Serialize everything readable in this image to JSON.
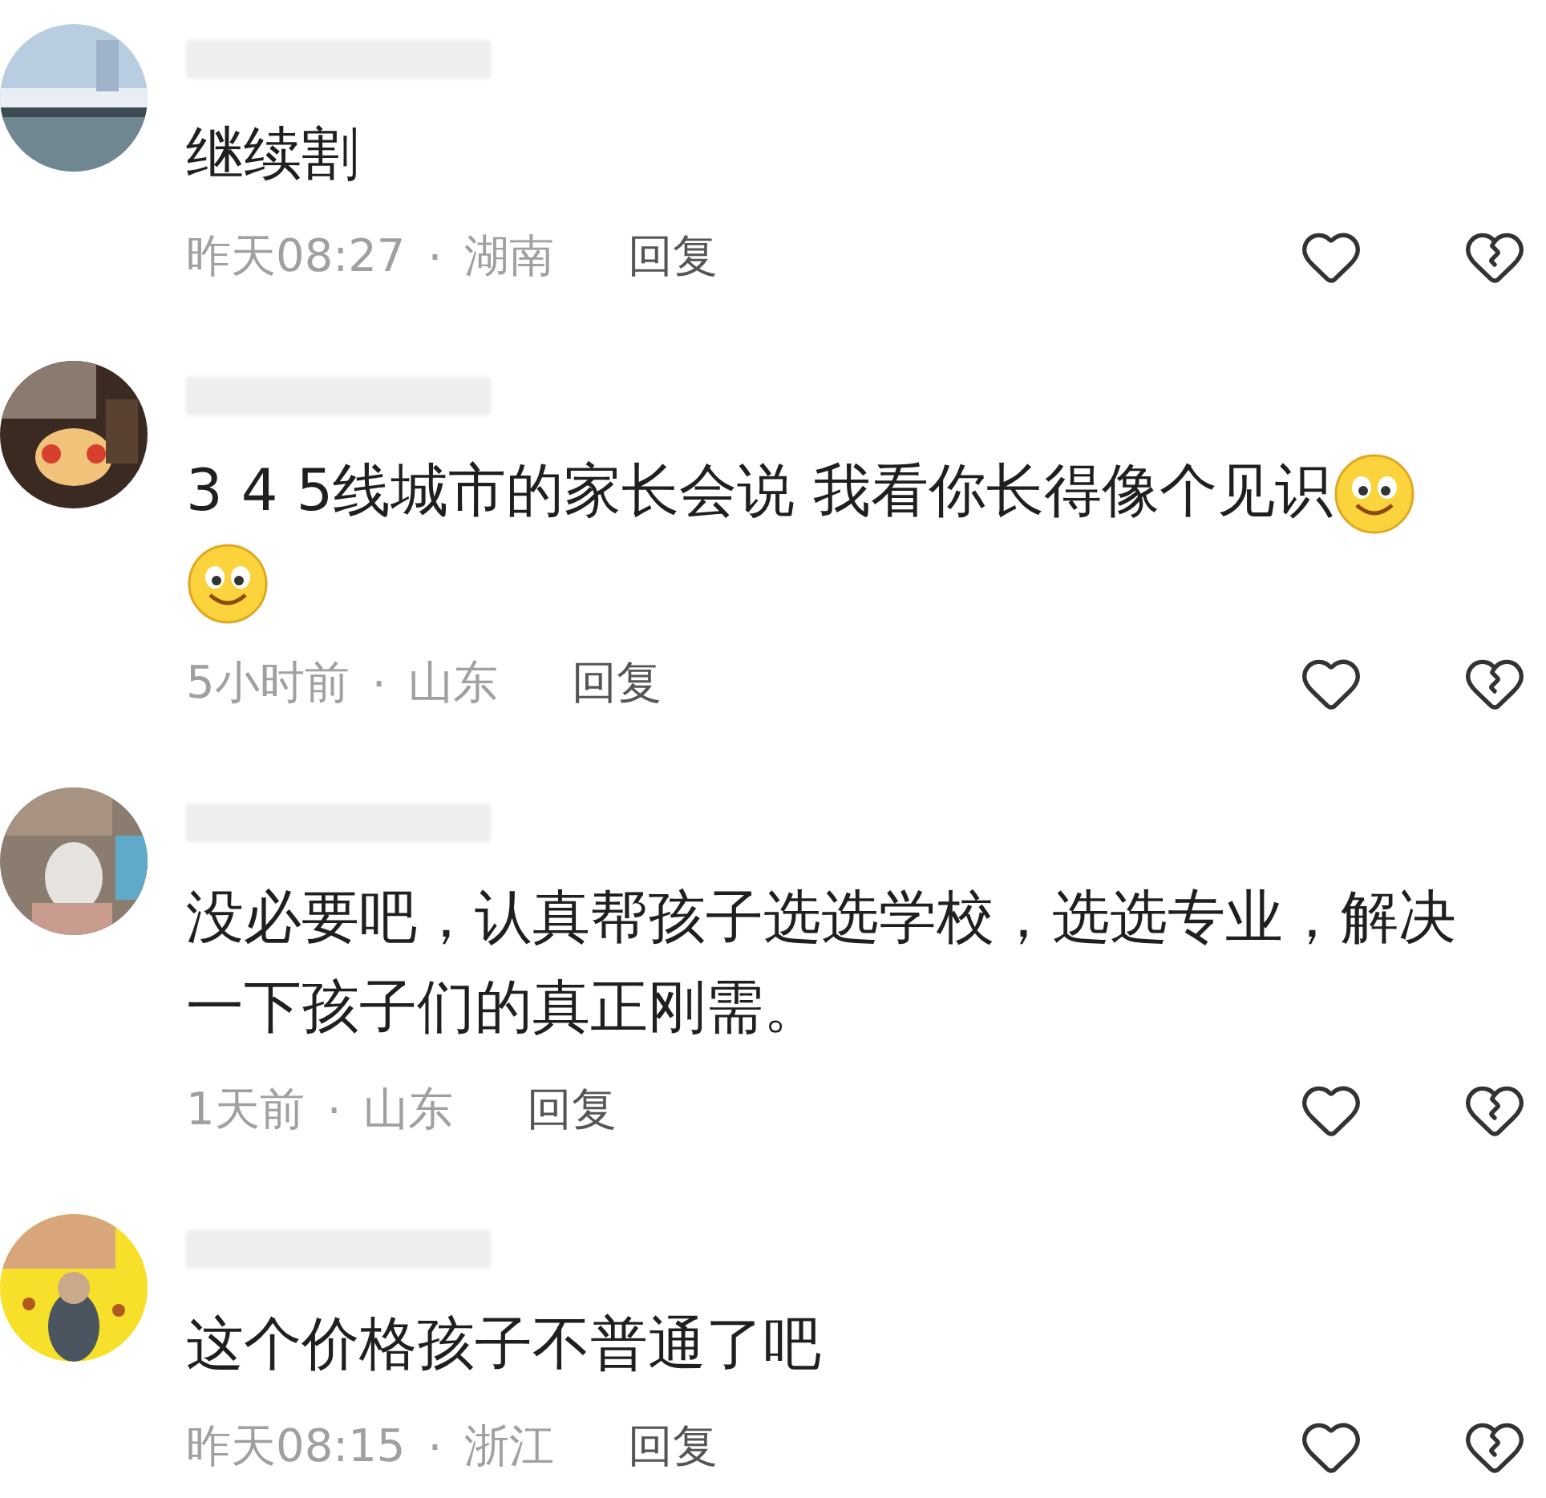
{
  "comments": [
    {
      "body": "继续割",
      "time": "昨天08:27",
      "separator": "·",
      "region": "湖南",
      "reply": "回复"
    },
    {
      "body": "3 4 5线城市的家长会说 我看你长得像个见识",
      "emojis": [
        {
          "kind": "smile"
        },
        {
          "kind": "smile"
        }
      ],
      "time": "5小时前",
      "separator": "·",
      "region": "山东",
      "reply": "回复"
    },
    {
      "body": "没必要吧，认真帮孩子选选学校，选选专业，解决一下孩子们的真正刚需。",
      "time": "1天前",
      "separator": "·",
      "region": "山东",
      "reply": "回复"
    },
    {
      "body": "这个价格孩子不普通了吧",
      "time": "昨天08:15",
      "separator": "·",
      "region": "浙江",
      "reply": "回复"
    }
  ]
}
